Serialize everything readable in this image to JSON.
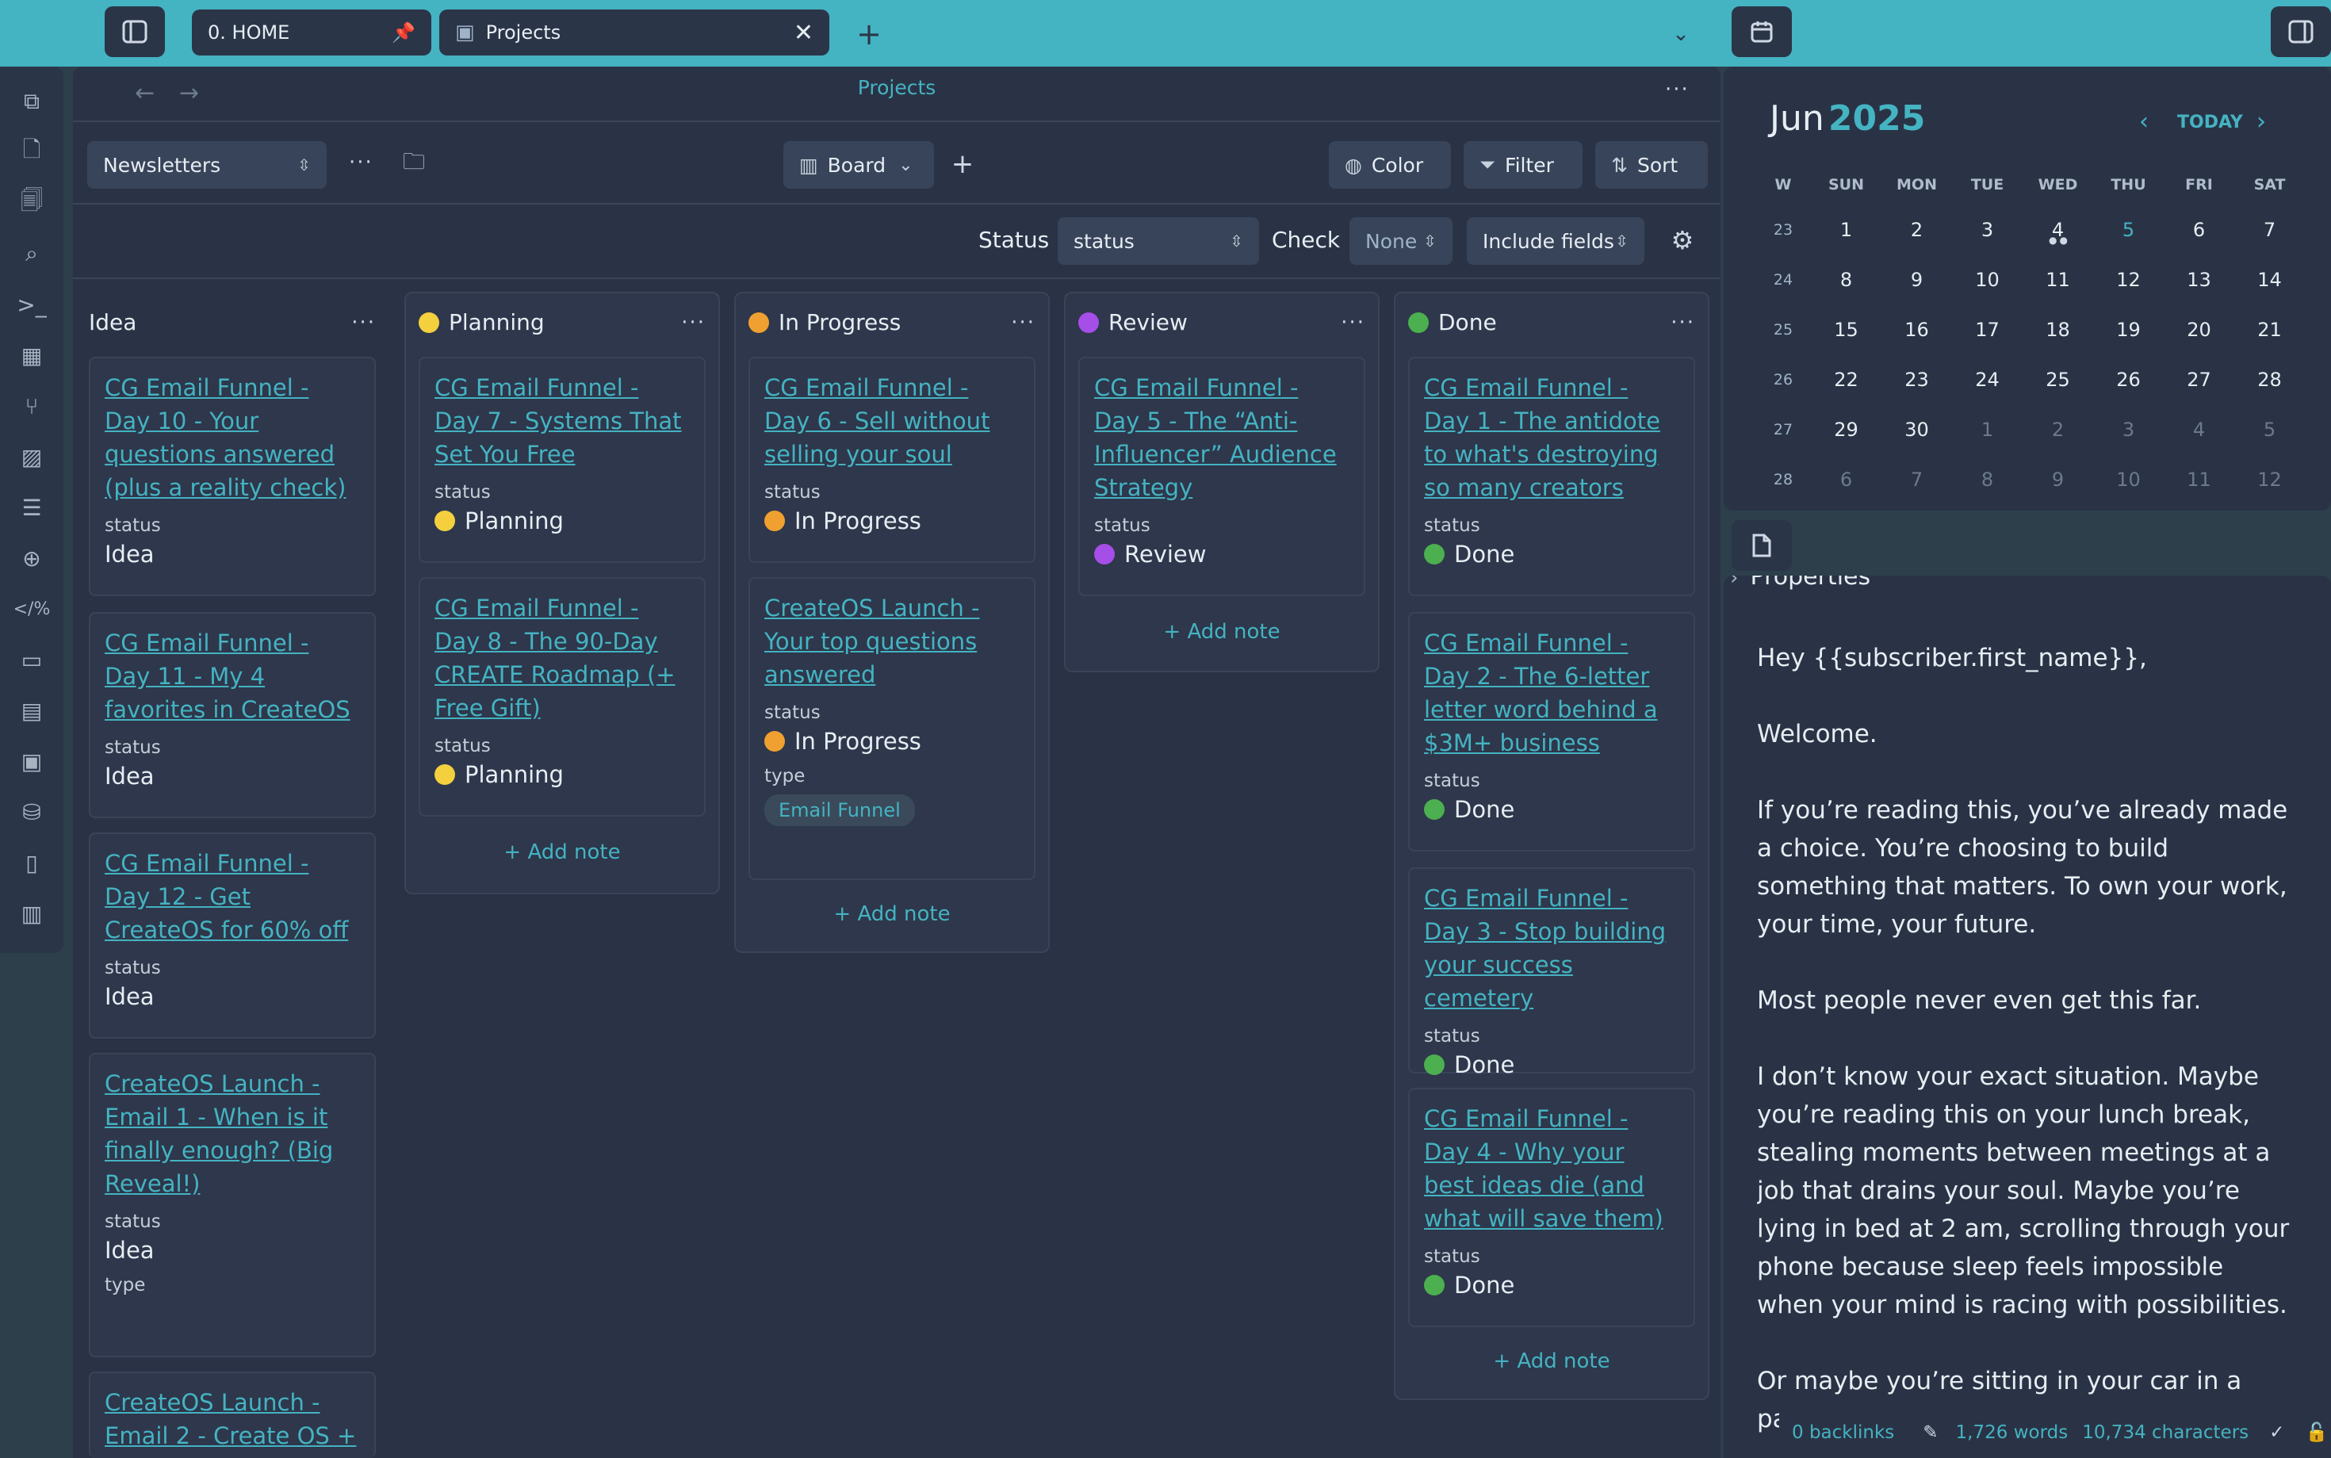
{
  "tabs": [
    {
      "label": "0. HOME",
      "icon": "home-icon"
    },
    {
      "label": "Projects",
      "icon": "board-icon"
    }
  ],
  "main": {
    "title": "Projects",
    "view_select": "Newsletters",
    "view_mode": "Board",
    "buttons": {
      "color": "Color",
      "filter": "Filter",
      "sort": "Sort"
    },
    "fields": {
      "status_label": "Status",
      "status_value": "status",
      "check_label": "Check",
      "check_value": "None",
      "include": "Include fields"
    }
  },
  "colors": {
    "accent": "#44b3c2",
    "planning": "#f4d03f",
    "in_progress": "#f0a030",
    "review": "#a64ee8",
    "done": "#4caf50"
  },
  "board": {
    "add_note": "Add note",
    "status_label": "status",
    "type_label": "type",
    "columns": [
      {
        "name": "Idea",
        "cards": [
          {
            "title": "CG Email Funnel - Day 10 - Your questions answered (plus a reality check)",
            "status": "Idea"
          },
          {
            "title": "CG Email Funnel - Day 11 - My 4 favorites in CreateOS",
            "status": "Idea"
          },
          {
            "title": "CG Email Funnel - Day 12 - Get CreateOS for 60% off",
            "status": "Idea"
          },
          {
            "title": "CreateOS Launch - Email 1 - When is it finally enough? (Big Reveal!)",
            "status": "Idea"
          },
          {
            "title": "CreateOS Launch - Email 2 - Create OS +"
          }
        ]
      },
      {
        "name": "Planning",
        "cards": [
          {
            "title": "CG Email Funnel - Day 7 - Systems That Set You Free",
            "status": "Planning"
          },
          {
            "title": "CG Email Funnel - Day 8 - The 90-Day CREATE Roadmap (+ Free Gift)",
            "status": "Planning"
          }
        ]
      },
      {
        "name": "In Progress",
        "cards": [
          {
            "title": "CG Email Funnel - Day 6 - Sell without selling your soul",
            "status": "In Progress"
          },
          {
            "title": "CreateOS Launch - Your top questions answered",
            "status": "In Progress",
            "type": "Email Funnel"
          }
        ]
      },
      {
        "name": "Review",
        "cards": [
          {
            "title": "CG Email Funnel - Day 5 - The “Anti-Influencer” Audience Strategy",
            "status": "Review"
          }
        ]
      },
      {
        "name": "Done",
        "cards": [
          {
            "title": "CG Email Funnel - Day 1 - The antidote to what's destroying so many creators",
            "status": "Done"
          },
          {
            "title": "CG Email Funnel - Day 2 - The 6-letter letter word behind a $3M+ business",
            "status": "Done"
          },
          {
            "title": "CG Email Funnel - Day 3 - Stop building your success cemetery",
            "status": "Done"
          },
          {
            "title": "CG Email Funnel - Day 4 - Why your best ideas die (and what will save them)",
            "status": "Done"
          }
        ]
      }
    ]
  },
  "calendar": {
    "month": "Jun",
    "year": "2025",
    "today": "TODAY",
    "headers": [
      "W",
      "SUN",
      "MON",
      "TUE",
      "WED",
      "THU",
      "FRI",
      "SAT"
    ],
    "weeks": [
      {
        "w": "23",
        "days": [
          "1",
          "2",
          "3",
          "4",
          "5",
          "6",
          "7"
        ]
      },
      {
        "w": "24",
        "days": [
          "8",
          "9",
          "10",
          "11",
          "12",
          "13",
          "14"
        ]
      },
      {
        "w": "25",
        "days": [
          "15",
          "16",
          "17",
          "18",
          "19",
          "20",
          "21"
        ]
      },
      {
        "w": "26",
        "days": [
          "22",
          "23",
          "24",
          "25",
          "26",
          "27",
          "28"
        ]
      },
      {
        "w": "27",
        "days": [
          "29",
          "30",
          "1",
          "2",
          "3",
          "4",
          "5"
        ]
      },
      {
        "w": "28",
        "days": [
          "6",
          "7",
          "8",
          "9",
          "10",
          "11",
          "12"
        ]
      }
    ]
  },
  "document": {
    "properties": "Properties",
    "paragraphs": [
      "Hey {{subscriber.first_name}},",
      "Welcome.",
      "If you’re reading this, you’ve already made a choice. You’re choosing to build something that matters. To own your work, your time, your future.",
      "Most people never even get this far.",
      "I don’t know your exact situation. Maybe you’re reading this on your lunch break, stealing moments between meetings at a job that drains your soul. Maybe you’re lying in bed at 2 am, scrolling through your phone because sleep feels impossible when your mind is racing with possibilities.",
      "Or maybe you’re sitting in your car in a parking lo"
    ]
  },
  "statusbar": {
    "backlinks": "0 backlinks",
    "words": "1,726 words",
    "characters": "10,734 characters"
  }
}
